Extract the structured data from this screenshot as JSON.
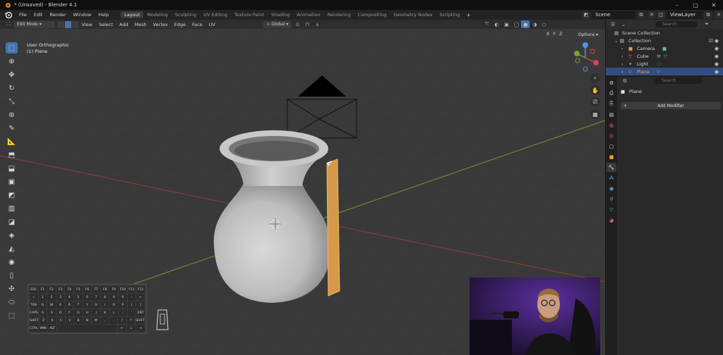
{
  "title": "* (Unsaved) - Blender 4.1",
  "menus": [
    "File",
    "Edit",
    "Render",
    "Window",
    "Help"
  ],
  "workspaces": [
    "Layout",
    "Modeling",
    "Sculpting",
    "UV Editing",
    "Texture Paint",
    "Shading",
    "Animation",
    "Rendering",
    "Compositing",
    "Geometry Nodes",
    "Scripting"
  ],
  "active_workspace": "Layout",
  "scene": "Scene",
  "view_layer": "ViewLayer",
  "viewport_header": {
    "mode": "Edit Mode",
    "menus": [
      "View",
      "Select",
      "Add",
      "Mesh",
      "Vertex",
      "Edge",
      "Face",
      "UV"
    ],
    "transform_orientation": "Global",
    "axes": [
      "X",
      "Y",
      "Z"
    ],
    "options": "Options"
  },
  "viewport_info": {
    "view": "User Orthographic",
    "object": "(1) Plane"
  },
  "outliner": {
    "search_placeholder": "Search",
    "root": "Scene Collection",
    "collection": "Collection",
    "items": [
      "Camera",
      "Cube",
      "Light",
      "Plane"
    ],
    "selected": "Plane"
  },
  "properties": {
    "search_placeholder": "Search",
    "object_name": "Plane",
    "add_modifier": "Add Modifier"
  },
  "keyboard": {
    "rows": [
      [
        "ESC",
        "F1",
        "F2",
        "F3",
        "F4",
        "F5",
        "F6",
        "F7",
        "F8",
        "F9",
        "F10",
        "F11",
        "F12"
      ],
      [
        "~",
        "1",
        "2",
        "3",
        "4",
        "5",
        "6",
        "7",
        "8",
        "9",
        "0",
        "-",
        "←"
      ],
      [
        "TAB",
        "Q",
        "W",
        "E",
        "R",
        "T",
        "Y",
        "U",
        "I",
        "O",
        "P",
        "[",
        "]"
      ],
      [
        "CAPS",
        "A",
        "S",
        "D",
        "F",
        "G",
        "H",
        "J",
        "K",
        "L",
        ";",
        "'",
        "ENT"
      ],
      [
        "SHIFT",
        "Z",
        "X",
        "C",
        "V",
        "B",
        "N",
        "M",
        ",",
        ".",
        "/",
        "↑",
        "SHIFT"
      ],
      [
        "CTRL",
        "WIN",
        "ALT",
        "",
        "",
        "",
        "",
        "",
        "",
        "",
        "←",
        "↓",
        "→"
      ]
    ]
  }
}
